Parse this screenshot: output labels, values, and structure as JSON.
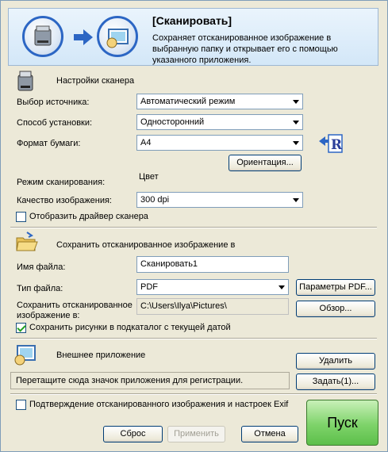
{
  "header": {
    "title": "[Сканировать]",
    "description": "Сохраняет отсканированное изображение в выбранную папку и открывает его с помощью указанного приложения."
  },
  "scanner": {
    "section_title": "Настройки сканера",
    "source_label": "Выбор источника:",
    "source_value": "Автоматический режим",
    "mode_label": "Способ установки:",
    "mode_value": "Односторонний",
    "paper_label": "Формат бумаги:",
    "paper_value": "A4",
    "orientation_button": "Ориентация...",
    "color_mode_label": "Режим сканирования:",
    "color_mode_value": "Цвет",
    "quality_label": "Качество изображения:",
    "quality_value": "300 dpi",
    "show_driver_label": "Отобразить драйвер сканера",
    "show_driver_checked": false
  },
  "save": {
    "section_title": "Сохранить отсканированное изображение в",
    "filename_label": "Имя файла:",
    "filename_value": "Сканировать1",
    "filetype_label": "Тип файла:",
    "filetype_value": "PDF",
    "pdf_params_button": "Параметры PDF...",
    "saveto_label": "Сохранить отсканированное изображение в:",
    "saveto_value": "C:\\Users\\Ilya\\Pictures\\",
    "browse_button": "Обзор...",
    "subfolder_label": "Сохранить рисунки в подкаталог с текущей датой",
    "subfolder_checked": true
  },
  "external_app": {
    "section_title": "Внешнее приложение",
    "delete_button": "Удалить",
    "dropzone_text": "Перетащите сюда значок приложения для регистрации.",
    "assign_button": "Задать(1)..."
  },
  "footer": {
    "confirm_label": "Подтверждение отсканированного изображения и настроек Exif",
    "confirm_checked": false,
    "reset_button": "Сброс",
    "apply_button": "Применить",
    "cancel_button": "Отмена",
    "go_button": "Пуск"
  }
}
